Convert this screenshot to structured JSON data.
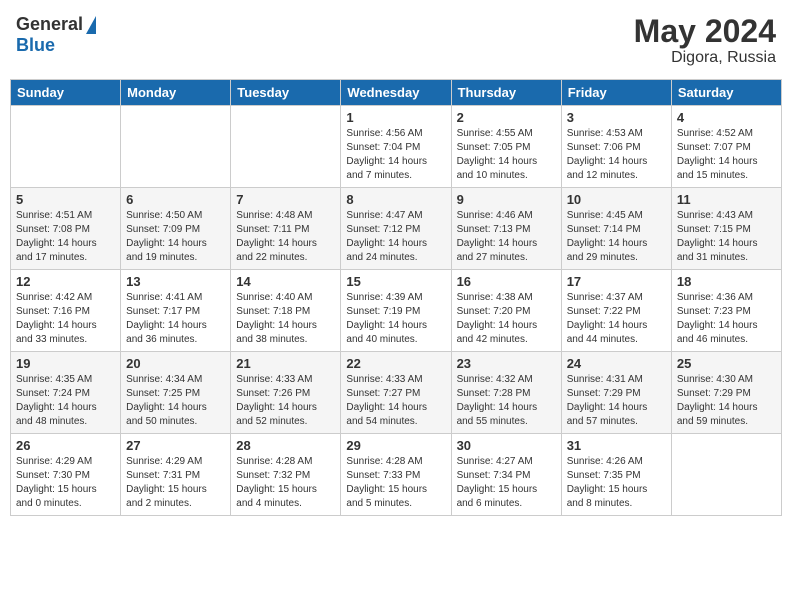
{
  "header": {
    "logo_general": "General",
    "logo_blue": "Blue",
    "month_year": "May 2024",
    "location": "Digora, Russia"
  },
  "weekdays": [
    "Sunday",
    "Monday",
    "Tuesday",
    "Wednesday",
    "Thursday",
    "Friday",
    "Saturday"
  ],
  "weeks": [
    [
      {
        "day": "",
        "info": ""
      },
      {
        "day": "",
        "info": ""
      },
      {
        "day": "",
        "info": ""
      },
      {
        "day": "1",
        "info": "Sunrise: 4:56 AM\nSunset: 7:04 PM\nDaylight: 14 hours\nand 7 minutes."
      },
      {
        "day": "2",
        "info": "Sunrise: 4:55 AM\nSunset: 7:05 PM\nDaylight: 14 hours\nand 10 minutes."
      },
      {
        "day": "3",
        "info": "Sunrise: 4:53 AM\nSunset: 7:06 PM\nDaylight: 14 hours\nand 12 minutes."
      },
      {
        "day": "4",
        "info": "Sunrise: 4:52 AM\nSunset: 7:07 PM\nDaylight: 14 hours\nand 15 minutes."
      }
    ],
    [
      {
        "day": "5",
        "info": "Sunrise: 4:51 AM\nSunset: 7:08 PM\nDaylight: 14 hours\nand 17 minutes."
      },
      {
        "day": "6",
        "info": "Sunrise: 4:50 AM\nSunset: 7:09 PM\nDaylight: 14 hours\nand 19 minutes."
      },
      {
        "day": "7",
        "info": "Sunrise: 4:48 AM\nSunset: 7:11 PM\nDaylight: 14 hours\nand 22 minutes."
      },
      {
        "day": "8",
        "info": "Sunrise: 4:47 AM\nSunset: 7:12 PM\nDaylight: 14 hours\nand 24 minutes."
      },
      {
        "day": "9",
        "info": "Sunrise: 4:46 AM\nSunset: 7:13 PM\nDaylight: 14 hours\nand 27 minutes."
      },
      {
        "day": "10",
        "info": "Sunrise: 4:45 AM\nSunset: 7:14 PM\nDaylight: 14 hours\nand 29 minutes."
      },
      {
        "day": "11",
        "info": "Sunrise: 4:43 AM\nSunset: 7:15 PM\nDaylight: 14 hours\nand 31 minutes."
      }
    ],
    [
      {
        "day": "12",
        "info": "Sunrise: 4:42 AM\nSunset: 7:16 PM\nDaylight: 14 hours\nand 33 minutes."
      },
      {
        "day": "13",
        "info": "Sunrise: 4:41 AM\nSunset: 7:17 PM\nDaylight: 14 hours\nand 36 minutes."
      },
      {
        "day": "14",
        "info": "Sunrise: 4:40 AM\nSunset: 7:18 PM\nDaylight: 14 hours\nand 38 minutes."
      },
      {
        "day": "15",
        "info": "Sunrise: 4:39 AM\nSunset: 7:19 PM\nDaylight: 14 hours\nand 40 minutes."
      },
      {
        "day": "16",
        "info": "Sunrise: 4:38 AM\nSunset: 7:20 PM\nDaylight: 14 hours\nand 42 minutes."
      },
      {
        "day": "17",
        "info": "Sunrise: 4:37 AM\nSunset: 7:22 PM\nDaylight: 14 hours\nand 44 minutes."
      },
      {
        "day": "18",
        "info": "Sunrise: 4:36 AM\nSunset: 7:23 PM\nDaylight: 14 hours\nand 46 minutes."
      }
    ],
    [
      {
        "day": "19",
        "info": "Sunrise: 4:35 AM\nSunset: 7:24 PM\nDaylight: 14 hours\nand 48 minutes."
      },
      {
        "day": "20",
        "info": "Sunrise: 4:34 AM\nSunset: 7:25 PM\nDaylight: 14 hours\nand 50 minutes."
      },
      {
        "day": "21",
        "info": "Sunrise: 4:33 AM\nSunset: 7:26 PM\nDaylight: 14 hours\nand 52 minutes."
      },
      {
        "day": "22",
        "info": "Sunrise: 4:33 AM\nSunset: 7:27 PM\nDaylight: 14 hours\nand 54 minutes."
      },
      {
        "day": "23",
        "info": "Sunrise: 4:32 AM\nSunset: 7:28 PM\nDaylight: 14 hours\nand 55 minutes."
      },
      {
        "day": "24",
        "info": "Sunrise: 4:31 AM\nSunset: 7:29 PM\nDaylight: 14 hours\nand 57 minutes."
      },
      {
        "day": "25",
        "info": "Sunrise: 4:30 AM\nSunset: 7:29 PM\nDaylight: 14 hours\nand 59 minutes."
      }
    ],
    [
      {
        "day": "26",
        "info": "Sunrise: 4:29 AM\nSunset: 7:30 PM\nDaylight: 15 hours\nand 0 minutes."
      },
      {
        "day": "27",
        "info": "Sunrise: 4:29 AM\nSunset: 7:31 PM\nDaylight: 15 hours\nand 2 minutes."
      },
      {
        "day": "28",
        "info": "Sunrise: 4:28 AM\nSunset: 7:32 PM\nDaylight: 15 hours\nand 4 minutes."
      },
      {
        "day": "29",
        "info": "Sunrise: 4:28 AM\nSunset: 7:33 PM\nDaylight: 15 hours\nand 5 minutes."
      },
      {
        "day": "30",
        "info": "Sunrise: 4:27 AM\nSunset: 7:34 PM\nDaylight: 15 hours\nand 6 minutes."
      },
      {
        "day": "31",
        "info": "Sunrise: 4:26 AM\nSunset: 7:35 PM\nDaylight: 15 hours\nand 8 minutes."
      },
      {
        "day": "",
        "info": ""
      }
    ]
  ]
}
